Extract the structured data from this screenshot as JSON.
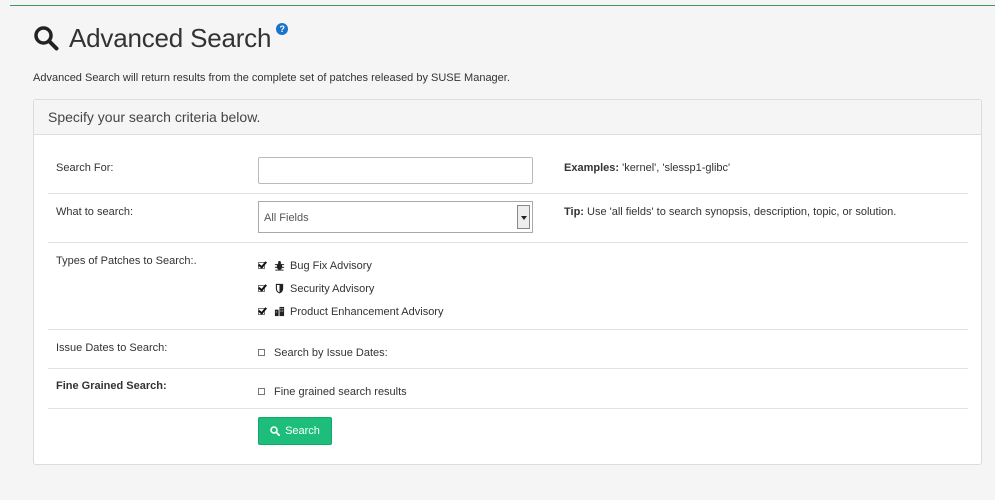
{
  "page": {
    "title": "Advanced Search",
    "help_glyph": "?",
    "intro": "Advanced Search will return results from the complete set of patches released by SUSE Manager."
  },
  "panel": {
    "heading": "Specify your search criteria below."
  },
  "form": {
    "search_for": {
      "label": "Search For:",
      "value": "",
      "examples_label": "Examples:",
      "examples_text": " 'kernel', 'slessp1-glibc'"
    },
    "what_to_search": {
      "label": "What to search:",
      "selected": "All Fields",
      "tip_label": "Tip:",
      "tip_text": " Use 'all fields' to search synopsis, description, topic, or solution."
    },
    "patch_types": {
      "label": "Types of Patches to Search:.",
      "options": [
        {
          "label": "Bug Fix Advisory",
          "checked": true,
          "icon": "bug-icon"
        },
        {
          "label": "Security Advisory",
          "checked": true,
          "icon": "shield-icon"
        },
        {
          "label": "Product Enhancement Advisory",
          "checked": true,
          "icon": "enhancement-icon"
        }
      ]
    },
    "issue_dates": {
      "label": "Issue Dates to Search:",
      "option_label": "Search by Issue Dates:",
      "checked": false
    },
    "fine_grained": {
      "label": "Fine Grained Search:",
      "option_label": "Fine grained search results",
      "checked": false
    },
    "submit_label": "Search"
  },
  "colors": {
    "accent": "#1dbd7b",
    "help_icon": "#1a73c8",
    "top_rule": "#3c9c5a"
  }
}
